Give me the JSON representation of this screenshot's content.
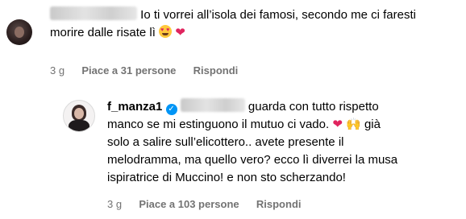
{
  "comment1": {
    "text": "Io ti vorrei all’isola dei famosi, secondo me ci faresti morire dalle risate lì",
    "time": "3 g",
    "likes": "Piace a 31 persone",
    "reply": "Rispondi"
  },
  "comment2": {
    "username": "f_manza1",
    "text_line1": "guarda con tutto rispetto",
    "text_line2": "manco se mi estinguono il mutuo ci vado.",
    "text_line2b": "già",
    "text_line3": "solo a salire sull’elicottero.. avete presente il",
    "text_line4": "melodramma, ma quello vero? ecco lì diverrei la musa",
    "text_line5": "ispiratrice di Muccino! e non sto scherzando!",
    "time": "3 g",
    "likes": "Piace a 103 persone",
    "reply": "Rispondi"
  },
  "icons": {
    "verified": "verified-badge-icon",
    "heart": "red-heart-emoji",
    "heart_eyes": "heart-eyes-emoji",
    "raised_hands": "raised-hands-emoji"
  }
}
